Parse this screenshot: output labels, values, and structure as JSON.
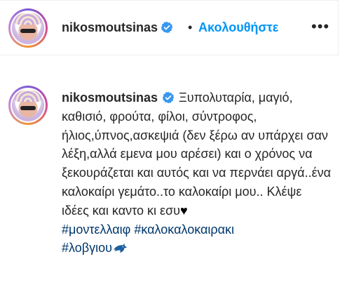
{
  "header": {
    "username": "nikosmoutsinas",
    "separator": "•",
    "follow_label": "Ακολουθήστε",
    "more_icon": "more-horizontal-icon"
  },
  "post": {
    "username": "nikosmoutsinas",
    "caption_text": "Ξυπολυταρία, μαγιό, καθισιό, φρούτα, φίλοι, σύντροφος, ήλιος,ύπνος,ασκεψιά (δεν ξέρω αν υπάρχει σαν λέξη,αλλά εμενα μου αρέσει) και ο χρόνος να ξεκουράζεται και αυτός και να περνάει αργά..ένα καλοκαίρι γεμάτο..το καλοκαίρι μου.. Κλέψε ιδέες και καντο κι εσυ",
    "heart": "♥",
    "hashtags": [
      "#μοντελλαιφ",
      "#καλοκαλοκαιρακι",
      "#λοβγιου"
    ]
  },
  "colors": {
    "link": "#0095f6",
    "hashtag": "#00376b",
    "verified": "#3897f0",
    "text": "#262626"
  }
}
